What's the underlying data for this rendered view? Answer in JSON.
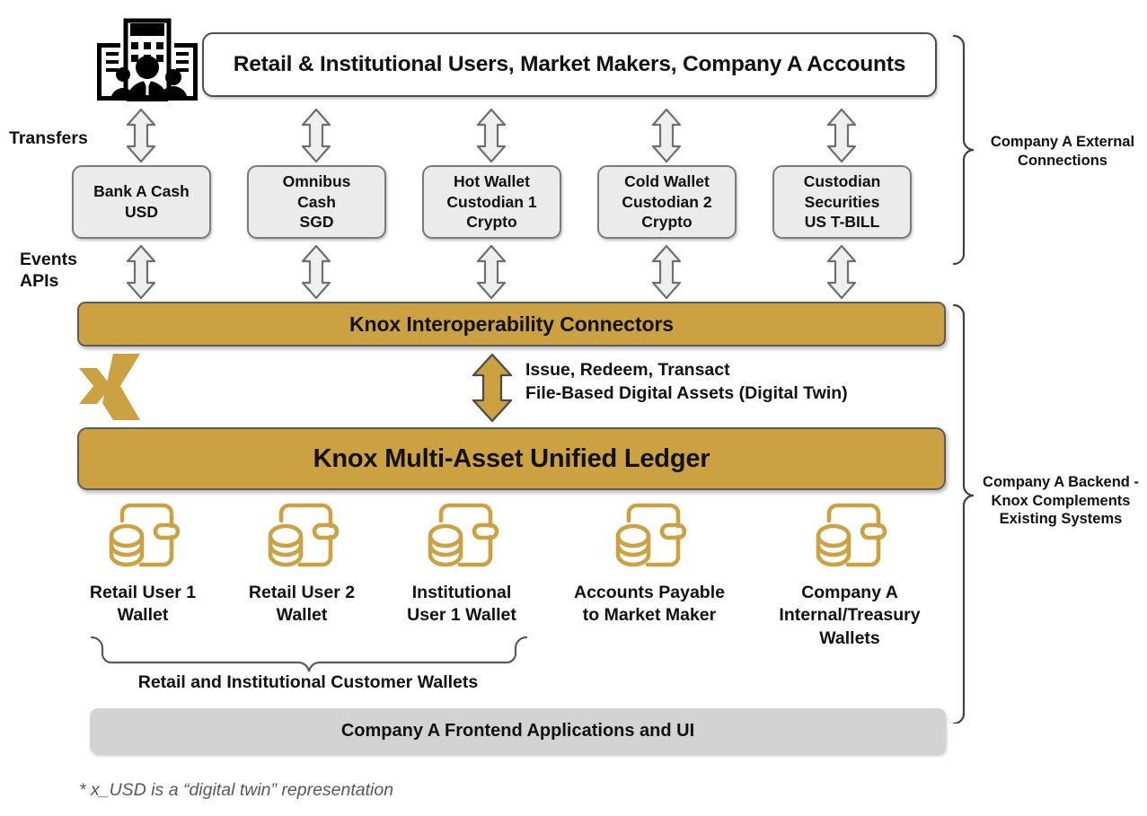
{
  "header": {
    "users_box_label": "Retail & Institutional Users, Market Makers, Company A Accounts",
    "users_icon_name": "people-building-icon"
  },
  "side_labels": {
    "transfers": "Transfers",
    "events_apis": "Events\nAPIs"
  },
  "external_accounts": [
    {
      "label": "Bank A Cash\nUSD"
    },
    {
      "label": "Omnibus\nCash\nSGD"
    },
    {
      "label": "Hot Wallet\nCustodian 1\nCrypto"
    },
    {
      "label": "Cold Wallet\nCustodian 2\nCrypto"
    },
    {
      "label": "Custodian\nSecurities\nUS T-BILL"
    }
  ],
  "bars": {
    "connectors": "Knox Interoperability Connectors",
    "ledger": "Knox Multi-Asset Unified Ledger",
    "frontend": "Company A Frontend Applications and UI"
  },
  "center_arrow_caption": "Issue, Redeem, Transact\nFile-Based Digital Assets (Digital Twin)",
  "wallets": [
    {
      "label": "Retail User 1\nWallet"
    },
    {
      "label": "Retail User 2\nWallet"
    },
    {
      "label": "Institutional\nUser 1 Wallet"
    },
    {
      "label": "Accounts Payable\nto Market Maker"
    },
    {
      "label": "Company A\nInternal/Treasury\nWallets"
    }
  ],
  "braces": {
    "external": "Company A External\nConnections",
    "backend": "Company A Backend -\nKnox Complements\nExisting Systems",
    "customer_wallets": "Retail and Institutional Customer Wallets"
  },
  "footnote": "* x_USD is a “digital twin” representation",
  "colors": {
    "gold": "#cca141",
    "box_gray": "#ebebeb",
    "bar_gray": "#d3d3d3",
    "outline": "#5c5c5c",
    "footnote_gray": "#585858"
  }
}
